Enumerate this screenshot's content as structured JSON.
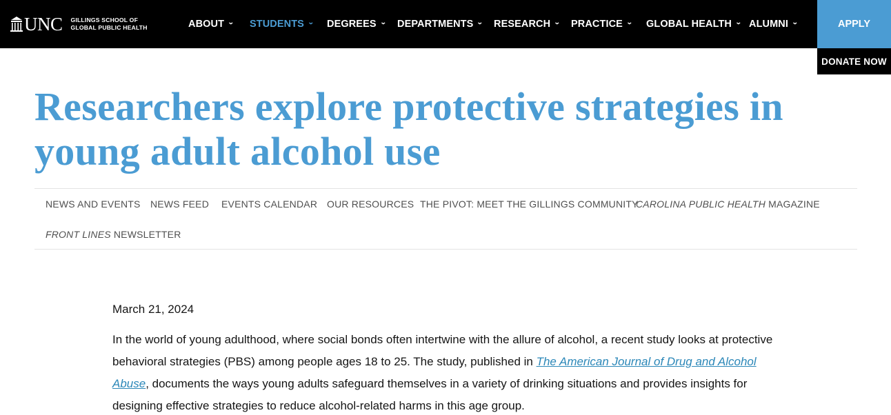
{
  "brand": {
    "logo_text": "UNC",
    "school_line1": "GILLINGS SCHOOL OF",
    "school_line2": "GLOBAL PUBLIC HEALTH"
  },
  "nav": {
    "items": [
      {
        "label": "ABOUT"
      },
      {
        "label": "STUDENTS"
      },
      {
        "label": "DEGREES"
      },
      {
        "label": "DEPARTMENTS"
      },
      {
        "label": "RESEARCH"
      },
      {
        "label": "PRACTICE"
      },
      {
        "label": "GLOBAL HEALTH"
      },
      {
        "label": "ALUMNI"
      }
    ],
    "chevron_icon": "chevron-down-icon",
    "active_index": 1,
    "apply_label": "APPLY",
    "donate_label": "DONATE NOW"
  },
  "headline": {
    "line1": "Researchers explore protective strategies in",
    "line2": "young adult alcohol use"
  },
  "subnav": {
    "news_and_events": "NEWS AND EVENTS",
    "news_feed": "NEWS FEED",
    "events_calendar": "EVENTS CALENDAR",
    "our_resources": "OUR RESOURCES",
    "the_pivot": "THE PIVOT: MEET THE GILLINGS COMMUNITY",
    "cph_italic": "CAROLINA PUBLIC HEALTH",
    "cph_rest": " MAGAZINE",
    "fl_italic": "FRONT LINES",
    "fl_rest": " NEWSLETTER"
  },
  "article": {
    "date": "March 21, 2024",
    "para_part1": "In the world of young adulthood, where social bonds often intertwine with the allure of alcohol, a recent study looks at protective behavioral strategies (PBS) among people ages 18 to 25. The study, published in ",
    "journal_link": "The American Journal of Drug and Alcohol Abuse",
    "para_part2": ", documents the ways young adults safeguard themselves in a variety of drinking situations and provides insights for designing effective strategies to reduce alcohol-related harms in this age group."
  },
  "colors": {
    "carolina_blue": "#4b9cd3",
    "link_blue": "#2b87b8",
    "topbar": "#000000"
  }
}
